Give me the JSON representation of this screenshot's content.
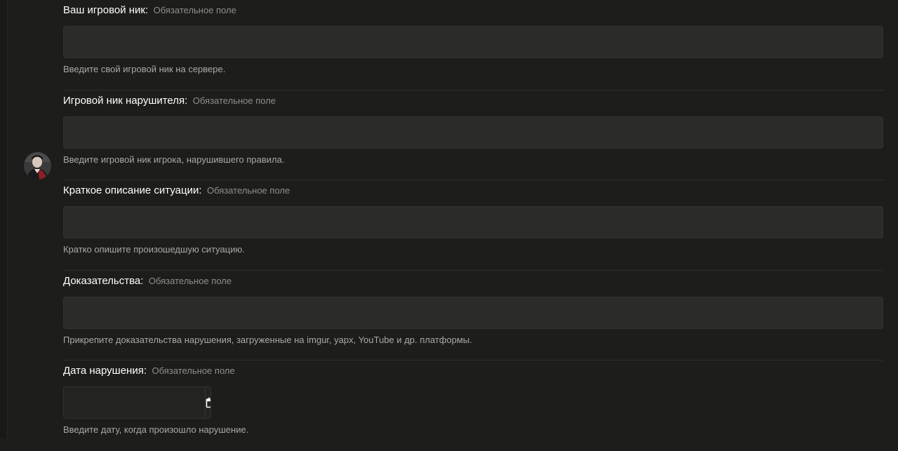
{
  "form": {
    "required_text": "Обязательное поле",
    "fields": [
      {
        "label": "Ваш игровой ник:",
        "value": "",
        "hint": "Введите свой игровой ник на сервере."
      },
      {
        "label": "Игровой ник нарушителя:",
        "value": "",
        "hint": "Введите игровой ник игрока, нарушившего правила."
      },
      {
        "label": "Краткое описание ситуации:",
        "value": "",
        "hint": "Кратко опишите произошедшую ситуацию."
      },
      {
        "label": "Доказательства:",
        "value": "",
        "hint": "Прикрепите доказательства нарушения, загруженные на imgur, yapx, YouTube и др. платформы."
      },
      {
        "label": "Дата нарушения:",
        "value": "",
        "hint": "Введите дату, когда произошло нарушение."
      }
    ]
  },
  "icons": {
    "avatar": "user-avatar",
    "date_picker": "calendar-icon"
  },
  "colors": {
    "background": "#1d1d1b",
    "input_background": "#2b2b29",
    "label": "#ffffff",
    "required": "#8f8f8d",
    "hint": "#a9a9a7"
  }
}
